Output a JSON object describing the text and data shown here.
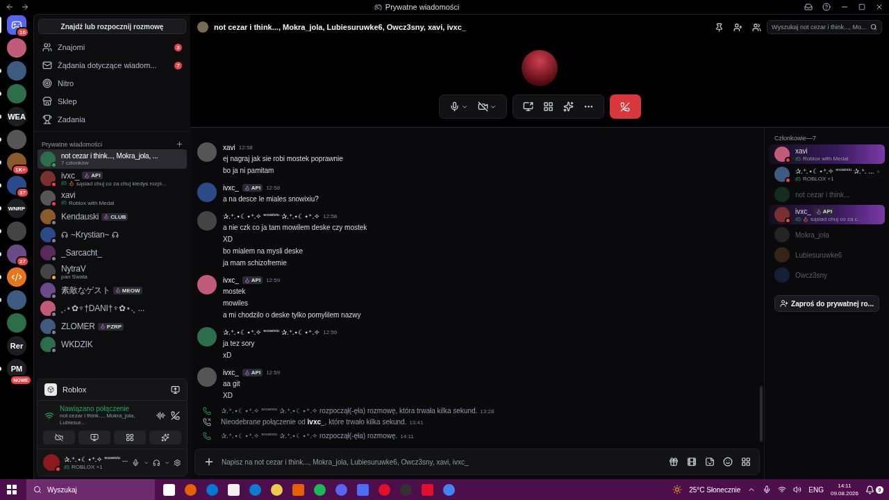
{
  "window": {
    "title": "Prywatne wiadomości"
  },
  "servers": [
    {
      "kind": "logo",
      "badge": "10",
      "selected": true,
      "unread": true
    },
    {
      "kind": "image",
      "unread": false,
      "selected": false
    },
    {
      "kind": "image",
      "unread": true,
      "selected": false
    },
    {
      "kind": "image",
      "unread": true,
      "selected": false
    },
    {
      "kind": "text",
      "label": "WEA",
      "unread": true,
      "selected": false
    },
    {
      "kind": "image",
      "unread": true,
      "selected": false
    },
    {
      "kind": "image",
      "badge": "1K+",
      "unread": true,
      "selected": false
    },
    {
      "kind": "image",
      "badge": "37",
      "unread": true,
      "selected": false
    },
    {
      "kind": "text",
      "label": "WNRP",
      "unread": true,
      "selected": false
    },
    {
      "kind": "image",
      "unread": true,
      "selected": false
    },
    {
      "kind": "image",
      "badge": "27",
      "unread": true,
      "selected": false
    },
    {
      "kind": "code",
      "unread": true,
      "selected": false
    },
    {
      "kind": "image",
      "unread": true,
      "selected": false
    },
    {
      "kind": "image",
      "unread": false,
      "selected": false
    },
    {
      "kind": "text",
      "label": "Rer",
      "unread": false,
      "selected": false
    },
    {
      "kind": "text",
      "label": "PM",
      "badge": "NOWE",
      "unread": true,
      "selected": false
    }
  ],
  "search_button": "Znajdź lub rozpocznij rozmowę",
  "nav": [
    {
      "kind": "friends",
      "label": "Znajomi",
      "badge": "3"
    },
    {
      "kind": "requests",
      "label": "Żądania dotyczące wiadom...",
      "badge": "7"
    },
    {
      "kind": "nitro",
      "label": "Nitro"
    },
    {
      "kind": "shop",
      "label": "Sklep"
    },
    {
      "kind": "quests",
      "label": "Zadania"
    }
  ],
  "dm_header": "Prywatne wiadomości",
  "dms": [
    {
      "name": "not cezar i think..., Mokra_jola, ...",
      "subtitle": "7 członków",
      "playing": false,
      "fire": false,
      "headphones": false,
      "color": "#23a55a",
      "selected": true
    },
    {
      "name": "ivxc_",
      "tag": "API",
      "subtitle": "sąsiad chuj co za chuj kiedys rozpi...",
      "playing": true,
      "fire": true,
      "headphones": false,
      "color": "#f23f43",
      "selected": false
    },
    {
      "name": "xavi",
      "subtitle": "Roblox with Medal",
      "playing": true,
      "fire": false,
      "headphones": false,
      "color": "#f23f43",
      "selected": false
    },
    {
      "name": "Kendauski",
      "tag": "CLUB",
      "playing": false,
      "fire": false,
      "headphones": false,
      "color": "#80848e",
      "selected": false
    },
    {
      "name": "~Krystian~",
      "playing": false,
      "fire": false,
      "headphones": true,
      "color": "#80848e",
      "selected": false
    },
    {
      "name": "_Sarcacht_",
      "playing": false,
      "fire": false,
      "headphones": false,
      "color": "#80848e",
      "selected": false
    },
    {
      "name": "NytraV",
      "subtitle": "pan Swata",
      "playing": false,
      "fire": false,
      "headphones": false,
      "color": "#f0b232",
      "selected": false
    },
    {
      "name": "素敵なゲスト",
      "tag": "MEOW",
      "playing": false,
      "fire": false,
      "headphones": false,
      "color": "#80848e",
      "selected": false
    },
    {
      "name": "˛.⋆✿♆†DANI†♆✿⋆.˛ ...",
      "playing": false,
      "fire": false,
      "headphones": false,
      "color": "#80848e",
      "selected": false
    },
    {
      "name": "ZLOMER",
      "tag": "PZRP",
      "playing": false,
      "fire": false,
      "headphones": false,
      "color": "#80848e",
      "selected": false
    },
    {
      "name": "WKDZIK",
      "playing": false,
      "fire": false,
      "headphones": false,
      "color": "#80848e",
      "selected": false
    }
  ],
  "activity_panel": {
    "app": "Roblox"
  },
  "voice_panel": {
    "status": "Nawiązano połączenie",
    "channel": "not cezar i think..., Mokra_jola, Lubiesur..."
  },
  "user_panel": {
    "name": "✰.⁺.⋆☾⋆⁺.✧ $^{snowixiu}$ ...",
    "activity": "ROBLOX +1"
  },
  "channel": {
    "title": "not cezar i think..., Mokra_jola, Lubiesuruwke6, Owcz3sny, xavi, ivxc_",
    "search_placeholder": "Wyszukaj not cezar i think..., Mo..."
  },
  "messages": [
    {
      "kind": "group",
      "author": "xavi",
      "time": "12:58",
      "lines": [
        "ej nagraj jak sie robi mostek poprawnie",
        "bo ja ni pamitam"
      ]
    },
    {
      "kind": "group",
      "author": "ivxc_",
      "tag": "API",
      "time": "12:58",
      "lines": [
        "a na desce le miales snowixiu?"
      ]
    },
    {
      "kind": "group",
      "author": "✰.⁺.⋆☾⋆⁺.✧ $^{snowixiu}$ ✰.⁺.⋆☾⋆⁺.✧",
      "time": "12:58",
      "lines": [
        "a nie czk co ja tam mowilem deske czy mostek",
        "XD",
        "bo mialem na mysli deske",
        "ja mam schizofremie"
      ]
    },
    {
      "kind": "group",
      "author": "ivxc_",
      "tag": "API",
      "time": "12:59",
      "lines": [
        "mostek",
        "mowiles",
        "a mi chodzilo o deske tylko pomylilem nazwy"
      ]
    },
    {
      "kind": "group",
      "author": "✰.⁺.⋆☾⋆⁺.✧ $^{snowixiu}$ ✰.⁺.⋆☾⋆⁺.✧",
      "time": "12:59",
      "lines": [
        "ja tez sory",
        "xD"
      ]
    },
    {
      "kind": "group",
      "author": "ivxc_",
      "tag": "API",
      "time": "12:59",
      "lines": [
        "aa git",
        "XD"
      ]
    },
    {
      "kind": "call",
      "text": "✰.⁺.⋆☾⋆⁺.✧ $^{snowixiu}$ ✰.⁺.⋆☾⋆⁺.✧ rozpoczął(-ęła) rozmowę, która trwała kilka sekund.",
      "time": "13:28"
    },
    {
      "kind": "missed",
      "text": "Nieodebrane połączenie od **ivxc_**, które trwało kilka sekund.",
      "time": "13:41"
    },
    {
      "kind": "call",
      "text": "✰.⁺.⋆☾⋆⁺.✧ $^{snowixiu}$ ✰.⁺.⋆☾⋆⁺.✧ rozpoczął(-ęła) rozmowę.",
      "time": "14:11"
    }
  ],
  "composer": {
    "placeholder": "Napisz na not cezar i think..., Mokra_jola, Lubiesuruwke6, Owcz3sny, xavi, ivxc_"
  },
  "members": {
    "header": "Członkowie—7",
    "items": [
      {
        "name": "xavi",
        "subtitle": "Roblox with Medal",
        "fire": false,
        "online": true,
        "color": "#f23f43",
        "featured": true,
        "owner": false
      },
      {
        "name": "✰.⁺.⋆☾⋆⁺.✧ $^{snowixiu}$ ✰.⁺. ...",
        "subtitle": "ROBLOX +1",
        "fire": false,
        "online": true,
        "color": "#f23f43",
        "featured": false,
        "owner": true
      },
      {
        "name": "not cezar i think...",
        "fire": false,
        "online": false,
        "featured": false,
        "owner": false
      },
      {
        "name": "ivxc_",
        "tag": "API",
        "subtitle": "sąsiad chuj co za c...",
        "fire": true,
        "online": true,
        "color": "#f23f43",
        "featured": true,
        "owner": false
      },
      {
        "name": "Mokra_jola",
        "fire": false,
        "online": false,
        "featured": false,
        "owner": false
      },
      {
        "name": "Lubiesuruwke6",
        "fire": false,
        "online": false,
        "featured": false,
        "owner": false
      },
      {
        "name": "Owcz3sny",
        "fire": false,
        "online": false,
        "featured": false,
        "owner": false
      }
    ],
    "invite_button": "Zaproś do prywatnej ro..."
  },
  "taskbar": {
    "search": "Wyszukaj",
    "weather": "25°C Słonecznie",
    "language": "ENG",
    "time": "14:11",
    "date": "09.08.2026",
    "notifications": "9"
  }
}
